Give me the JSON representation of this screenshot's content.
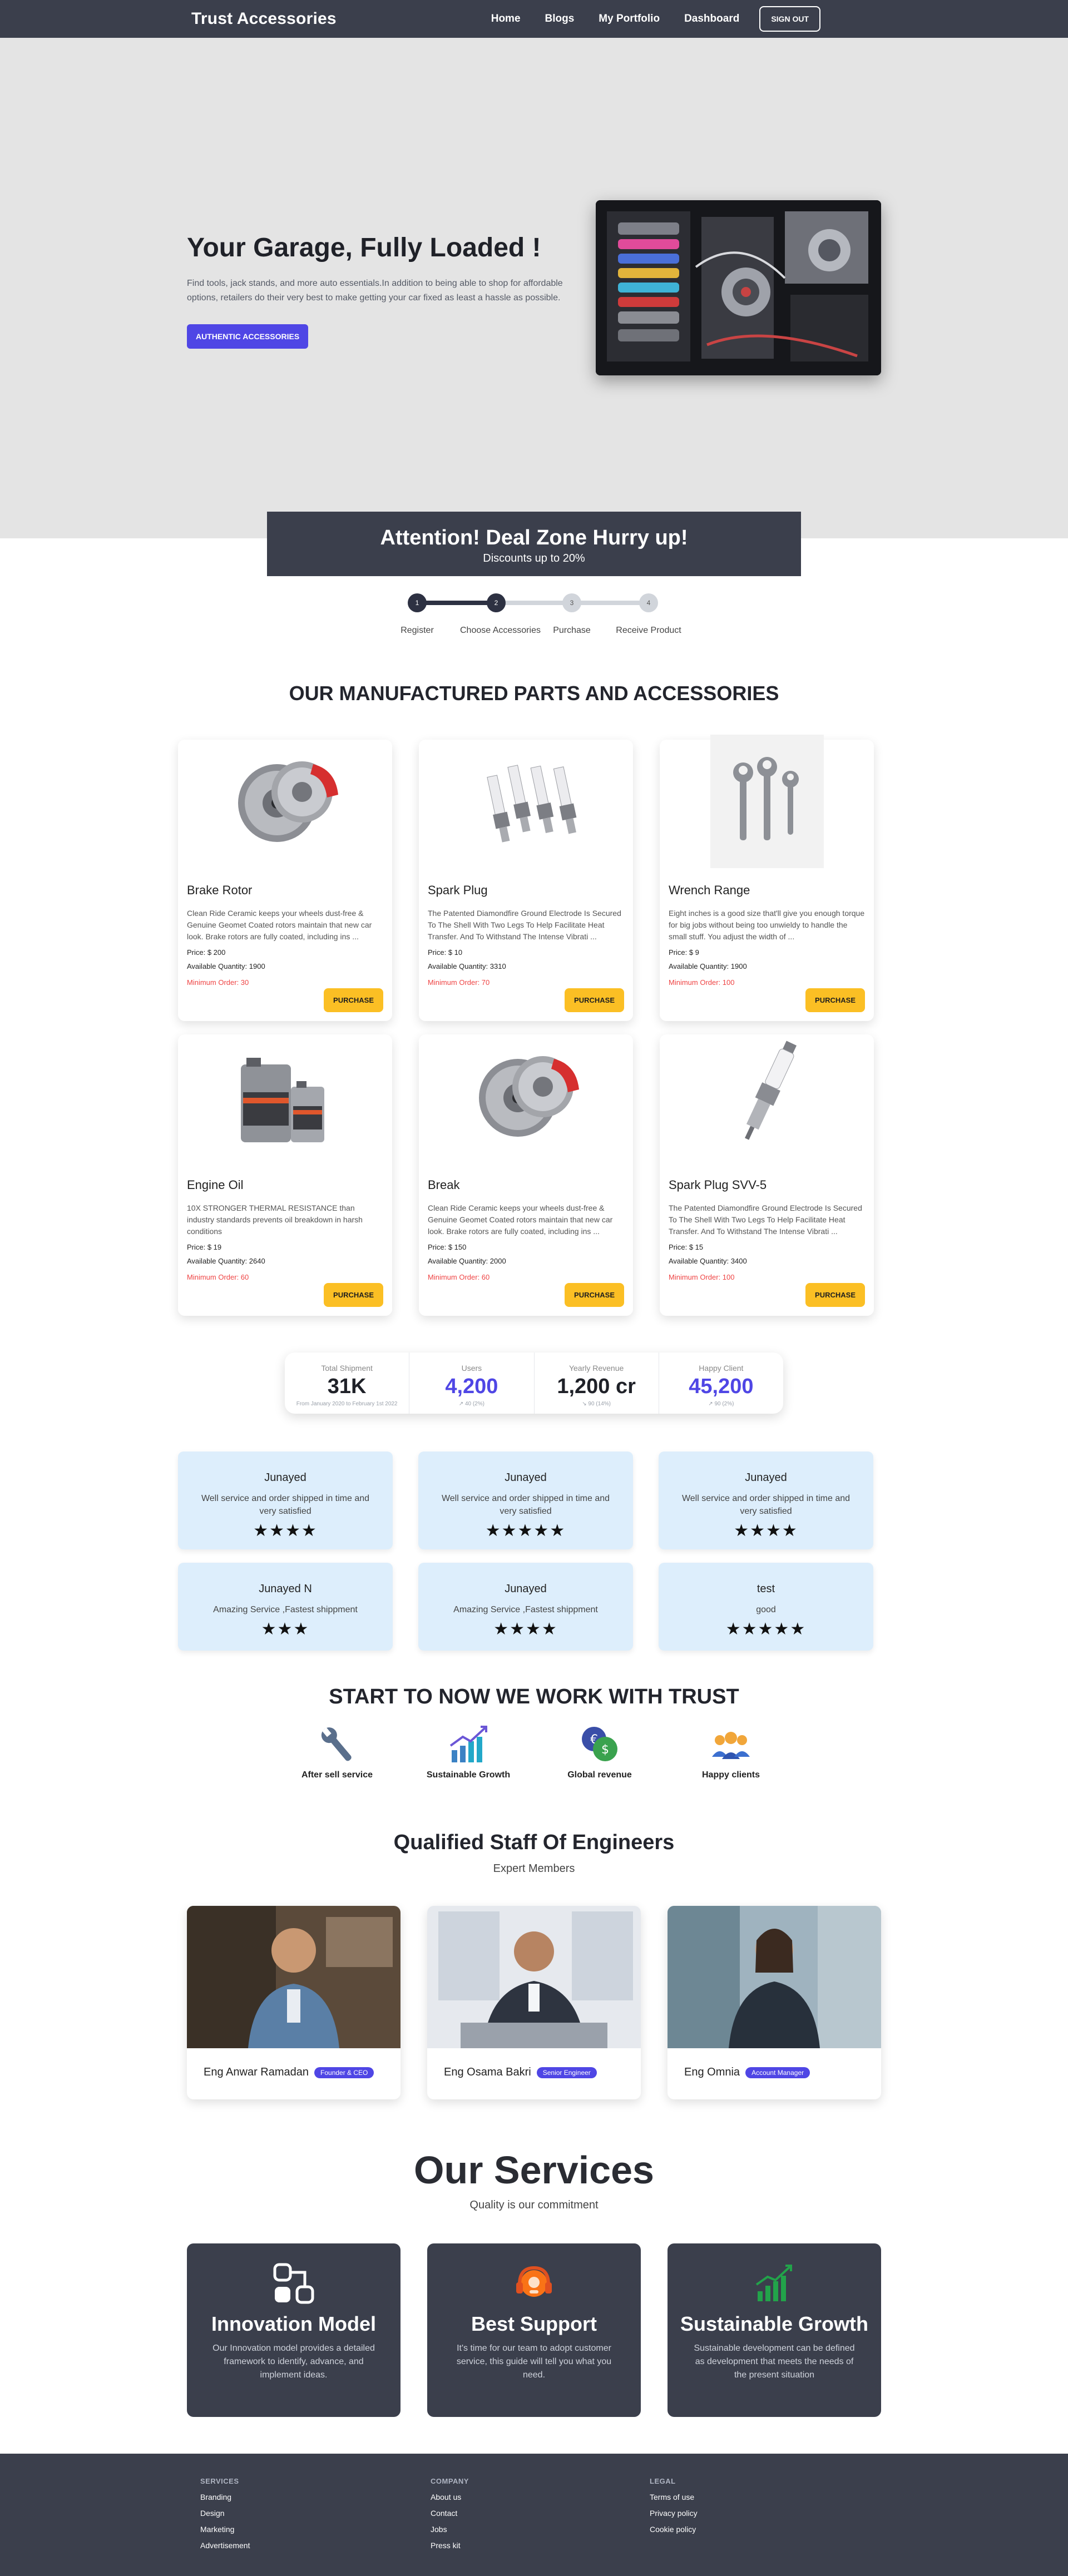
{
  "nav": {
    "brand": "Trust Accessories",
    "links": [
      "Home",
      "Blogs",
      "My Portfolio",
      "Dashboard"
    ],
    "signout": "SIGN OUT"
  },
  "hero": {
    "title": "Your Garage, Fully Loaded !",
    "description": "Find tools, jack stands, and more auto essentials.In addition to being able to shop for affordable options, retailers do their very best to make getting your car fixed as least a hassle as possible.",
    "button": "AUTHENTIC ACCESSORIES"
  },
  "deal": {
    "title": "Attention! Deal Zone Hurry up!",
    "subtitle": "Discounts up to 20%"
  },
  "steps": {
    "completed": 2,
    "items": [
      {
        "num": "1",
        "label": "Register"
      },
      {
        "num": "2",
        "label": "Choose Accessories"
      },
      {
        "num": "3",
        "label": "Purchase"
      },
      {
        "num": "4",
        "label": "Receive Product"
      }
    ]
  },
  "products_title": "OUR MANUFACTURED PARTS AND ACCESSORIES",
  "products": [
    {
      "name": "Brake Rotor",
      "desc": "Clean Ride Ceramic keeps your wheels dust-free & Genuine Geomet Coated rotors maintain that new car look. Brake rotors are fully coated, including ins ...",
      "price": "Price: $ 200",
      "qty": "Available Quantity: 1900",
      "min": "Minimum Order: 30",
      "button": "PURCHASE",
      "icon": "brake-rotor-image"
    },
    {
      "name": "Spark Plug",
      "desc": "The Patented Diamondfire Ground Electrode Is Secured To The Shell With Two Legs To Help Facilitate Heat Transfer. And To Withstand The Intense Vibrati ...",
      "price": "Price: $ 10",
      "qty": "Available Quantity: 3310",
      "min": "Minimum Order: 70",
      "button": "PURCHASE",
      "icon": "spark-plug-image"
    },
    {
      "name": "Wrench Range",
      "desc": "Eight inches is a good size that'll give you enough torque for big jobs without being too unwieldy to handle the small stuff. You adjust the width of ...",
      "price": "Price: $ 9",
      "qty": "Available Quantity: 1900",
      "min": "Minimum Order: 100",
      "button": "PURCHASE",
      "icon": "wrench-image"
    },
    {
      "name": "Engine Oil",
      "desc": "10X STRONGER THERMAL RESISTANCE than industry standards prevents oil breakdown in harsh conditions",
      "price": "Price: $ 19",
      "qty": "Available Quantity: 2640",
      "min": "Minimum Order: 60",
      "button": "PURCHASE",
      "icon": "engine-oil-image"
    },
    {
      "name": "Break",
      "desc": "Clean Ride Ceramic keeps your wheels dust-free & Genuine Geomet Coated rotors maintain that new car look. Brake rotors are fully coated, including ins ...",
      "price": "Price: $ 150",
      "qty": "Available Quantity: 2000",
      "min": "Minimum Order: 60",
      "button": "PURCHASE",
      "icon": "brake-rotor-image"
    },
    {
      "name": "Spark Plug SVV-5",
      "desc": "The Patented Diamondfire Ground Electrode Is Secured To The Shell With Two Legs To Help Facilitate Heat Transfer. And To Withstand The Intense Vibrati ...",
      "price": "Price: $ 15",
      "qty": "Available Quantity: 3400",
      "min": "Minimum Order: 100",
      "button": "PURCHASE",
      "icon": "single-spark-plug-image"
    }
  ],
  "stats": [
    {
      "title": "Total Shipment",
      "value": "31K",
      "desc": "From January 2020 to February 1st 2022",
      "color": "#1f2128"
    },
    {
      "title": "Users",
      "value": "4,200",
      "desc": "↗︎ 40 (2%)",
      "color": "#4f46e5"
    },
    {
      "title": "Yearly Revenue",
      "value": "1,200 cr",
      "desc": "↘︎ 90 (14%)",
      "color": "#1f2128"
    },
    {
      "title": "Happy Client",
      "value": "45,200",
      "desc": "↗︎ 90 (2%)",
      "color": "#4f46e5"
    }
  ],
  "reviews": [
    {
      "name": "Junayed",
      "text": "Well service and order shipped in time and very satisfied",
      "stars": "★★★★"
    },
    {
      "name": "Junayed",
      "text": "Well service and order shipped in time and very satisfied",
      "stars": "★★★★★"
    },
    {
      "name": "Junayed",
      "text": "Well service and order shipped in time and very satisfied",
      "stars": "★★★★"
    },
    {
      "name": "Junayed N",
      "text": "Amazing Service ,Fastest shippment",
      "stars": "★★★"
    },
    {
      "name": "Junayed",
      "text": "Amazing Service ,Fastest shippment",
      "stars": "★★★★"
    },
    {
      "name": "test",
      "text": "good",
      "stars": "★★★★★"
    }
  ],
  "trust": {
    "title": "START TO NOW WE WORK WITH TRUST",
    "items": [
      {
        "label": "After sell service",
        "icon": "wrench-icon"
      },
      {
        "label": "Sustainable Growth",
        "icon": "growth-chart-icon"
      },
      {
        "label": "Global revenue",
        "icon": "currency-exchange-icon"
      },
      {
        "label": "Happy clients",
        "icon": "clients-group-icon"
      }
    ]
  },
  "staff": {
    "title": "Qualified Staff Of Engineers",
    "subtitle": "Expert Members",
    "members": [
      {
        "name": "Eng Anwar Ramadan",
        "role": "Founder & CEO"
      },
      {
        "name": "Eng Osama Bakri",
        "role": "Senior Engineer"
      },
      {
        "name": "Eng Omnia",
        "role": "Account Manager"
      }
    ]
  },
  "services": {
    "title": "Our Services",
    "subtitle": "Quality is our commitment",
    "items": [
      {
        "title": "Innovation Model",
        "desc": "Our Innovation model provides a detailed framework to identify, advance, and implement ideas.",
        "icon": "innovation-icon"
      },
      {
        "title": "Best Support",
        "desc": "It's time for our team to adopt customer service, this guide will tell you what you need.",
        "icon": "support-headset-icon"
      },
      {
        "title": "Sustainable Growth",
        "desc": "Sustainable development can be defined as development that meets the needs of the present situation",
        "icon": "growth-bars-icon"
      }
    ]
  },
  "footer": {
    "columns": [
      {
        "title": "SERVICES",
        "links": [
          "Branding",
          "Design",
          "Marketing",
          "Advertisement"
        ]
      },
      {
        "title": "COMPANY",
        "links": [
          "About us",
          "Contact",
          "Jobs",
          "Press kit"
        ]
      },
      {
        "title": "LEGAL",
        "links": [
          "Terms of use",
          "Privacy policy",
          "Cookie policy"
        ]
      }
    ]
  },
  "colors": {
    "nav": "#3b3f4c",
    "primary": "#4f46e5",
    "accent": "#fbbf24",
    "danger": "#ef4444",
    "review_bg": "#ddeefc"
  }
}
